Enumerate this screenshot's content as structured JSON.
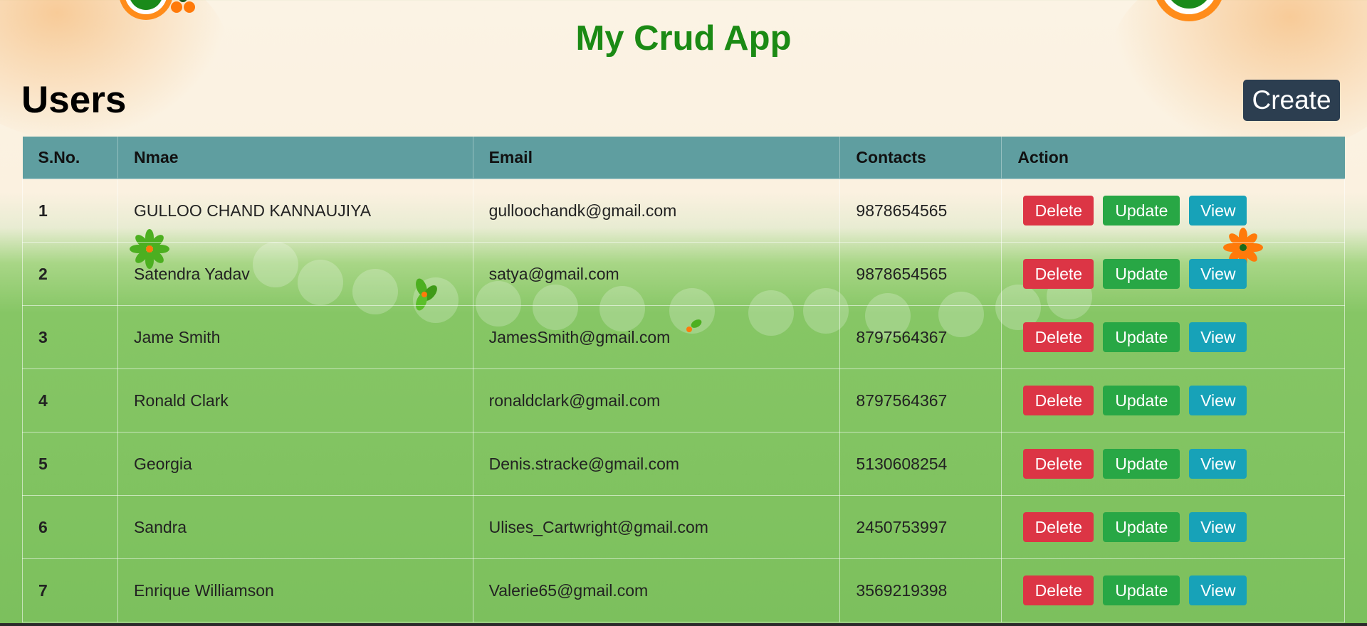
{
  "app": {
    "title": "My Crud App"
  },
  "page": {
    "heading": "Users",
    "create_label": "Create"
  },
  "table": {
    "headers": [
      "S.No.",
      "Nmae",
      "Email",
      "Contacts",
      "Action"
    ],
    "rows": [
      {
        "sno": "1",
        "name": "GULLOO CHAND KANNAUJIYA",
        "email": "gulloochandk@gmail.com",
        "contact": "9878654565"
      },
      {
        "sno": "2",
        "name": "Satendra Yadav",
        "email": "satya@gmail.com",
        "contact": "9878654565"
      },
      {
        "sno": "3",
        "name": "Jame Smith",
        "email": "JamesSmith@gmail.com",
        "contact": "8797564367"
      },
      {
        "sno": "4",
        "name": "Ronald Clark",
        "email": "ronaldclark@gmail.com",
        "contact": "8797564367"
      },
      {
        "sno": "5",
        "name": "Georgia",
        "email": "Denis.stracke@gmail.com",
        "contact": "5130608254"
      },
      {
        "sno": "6",
        "name": "Sandra",
        "email": "Ulises_Cartwright@gmail.com",
        "contact": "2450753997"
      },
      {
        "sno": "7",
        "name": "Enrique Williamson",
        "email": "Valerie65@gmail.com",
        "contact": "3569219398"
      }
    ],
    "actions": {
      "delete": "Delete",
      "update": "Update",
      "view": "View"
    }
  },
  "colors": {
    "title": "#1b8a14",
    "header_bg": "#5f9ea0",
    "create_bg": "#2c3e50",
    "delete": "#dc3545",
    "update": "#28a745",
    "view": "#17a2b8"
  }
}
